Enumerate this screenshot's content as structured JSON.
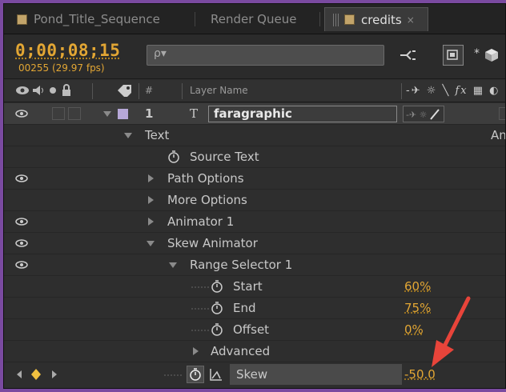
{
  "tabs": [
    {
      "label": "Pond_Title_Sequence"
    },
    {
      "label": "Render Queue"
    },
    {
      "label": "credits",
      "close": "×"
    }
  ],
  "toolbar": {
    "timecode": "0;00;08;15",
    "fps": "00255 (29.97 fps)",
    "search_placeholder": "ρ▾"
  },
  "header": {
    "hash": "#",
    "layer_name": "Layer Name",
    "right_cut": "An"
  },
  "layer": {
    "number": "1",
    "type_icon": "T",
    "name": "faragraphic"
  },
  "rows": {
    "text": "Text",
    "source_text": "Source Text",
    "path_options": "Path Options",
    "more_options": "More Options",
    "animator1": "Animator 1",
    "skew_animator": "Skew Animator",
    "range_selector": "Range Selector 1",
    "start": "Start",
    "start_val": "60%",
    "end": "End",
    "end_val": "75%",
    "offset": "Offset",
    "offset_val": "0%",
    "advanced": "Advanced",
    "skew": "Skew",
    "skew_val": "-50.0"
  },
  "colors": {
    "accent": "#e2a634",
    "arrow": "#e8443a",
    "label_swatch": "#c2a46a",
    "layer_color": "#b7a8d8"
  },
  "icons": [
    "eye-icon",
    "speaker-icon",
    "lock-icon",
    "label-icon",
    "stopwatch-icon",
    "graph-icon",
    "search-icon",
    "keyframe-icon"
  ]
}
